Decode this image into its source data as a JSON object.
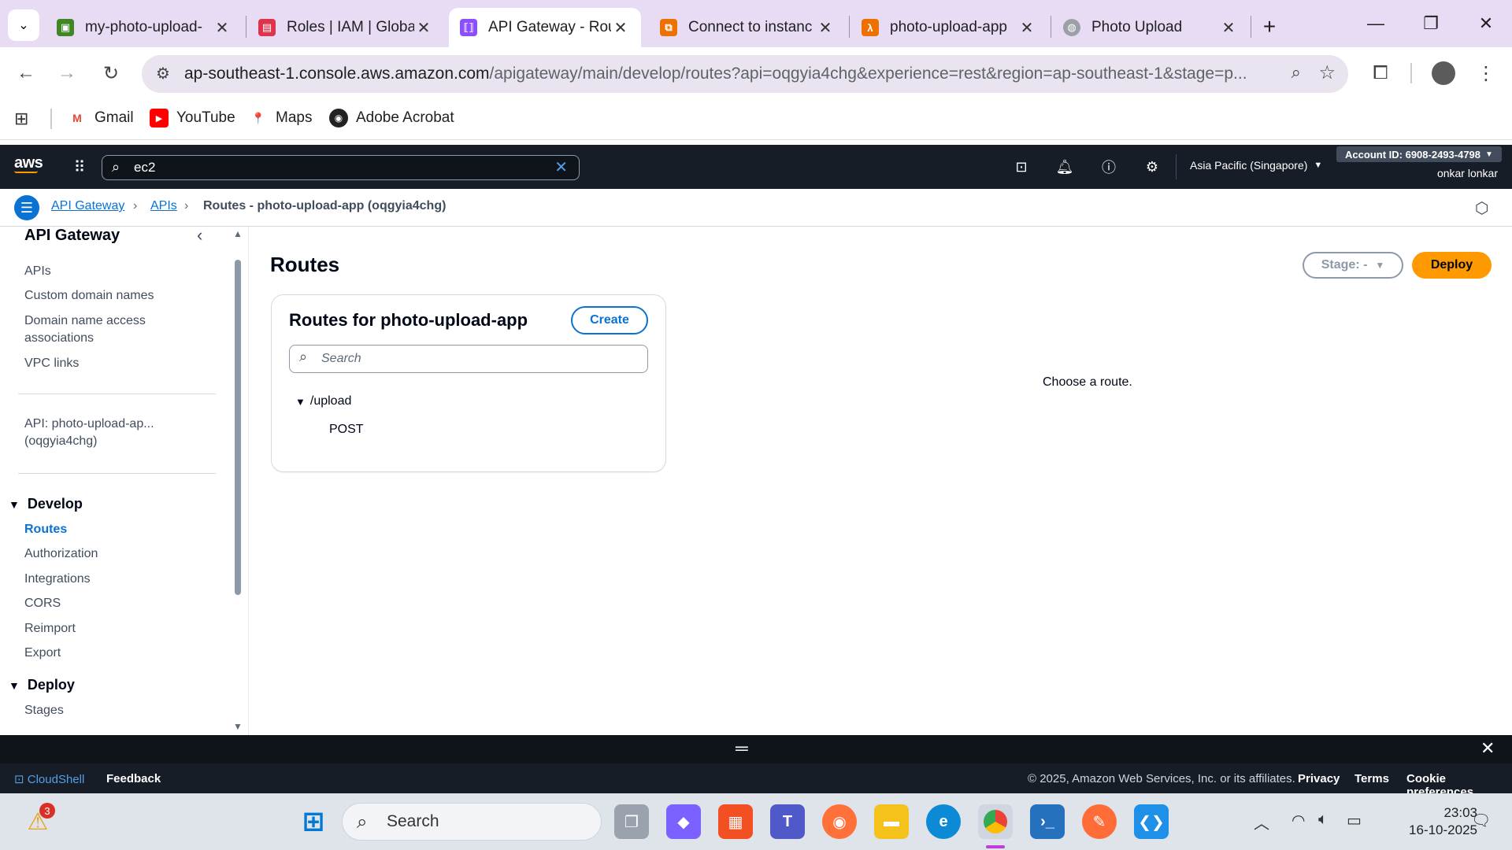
{
  "browser": {
    "tabs": [
      {
        "title": "my-photo-upload-",
        "favicon": "s3-icon",
        "color": "#3f8624"
      },
      {
        "title": "Roles | IAM | Globa",
        "favicon": "iam-icon",
        "color": "#dd344c"
      },
      {
        "title": "API Gateway - Rou",
        "favicon": "api-gateway-icon",
        "color": "#8c4fff"
      },
      {
        "title": "Connect to instanc",
        "favicon": "ec2-icon",
        "color": "#ed7100"
      },
      {
        "title": "photo-upload-app",
        "favicon": "lambda-icon",
        "color": "#ed7100"
      },
      {
        "title": "Photo Upload",
        "favicon": "globe-icon",
        "color": "#9aa0a6"
      }
    ],
    "active_tab_index": 2,
    "url_host": "ap-southeast-1.console.aws.amazon.com",
    "url_rest": "/apigateway/main/develop/routes?api=oqgyia4chg&experience=rest&region=ap-southeast-1&stage=p...",
    "bookmarks": [
      {
        "label": "Gmail",
        "icon": "gmail-icon"
      },
      {
        "label": "YouTube",
        "icon": "youtube-icon"
      },
      {
        "label": "Maps",
        "icon": "maps-icon"
      },
      {
        "label": "Adobe Acrobat",
        "icon": "acrobat-icon"
      }
    ]
  },
  "aws_nav": {
    "search_value": "ec2",
    "region": "Asia Pacific (Singapore)",
    "account_id": "Account ID: 6908-2493-4798",
    "user": "onkar lonkar"
  },
  "breadcrumb": {
    "items": [
      "API Gateway",
      "APIs",
      "Routes - photo-upload-app (oqgyia4chg)"
    ]
  },
  "sidebar": {
    "title": "API Gateway",
    "top_items": [
      "APIs",
      "Custom domain names",
      "Domain name access associations",
      "VPC links"
    ],
    "api_label": "API: photo-upload-ap... (oqgyia4chg)",
    "sections": [
      {
        "label": "Develop",
        "items": [
          "Routes",
          "Authorization",
          "Integrations",
          "CORS",
          "Reimport",
          "Export"
        ],
        "active": "Routes"
      },
      {
        "label": "Deploy",
        "items": [
          "Stages"
        ]
      }
    ]
  },
  "main": {
    "title": "Routes",
    "stage_label": "Stage: -",
    "deploy_label": "Deploy",
    "card_title": "Routes for photo-upload-app",
    "create_label": "Create",
    "search_placeholder": "Search",
    "route_path": "/upload",
    "route_method": "POST",
    "empty_message": "Choose a route."
  },
  "footer": {
    "cloudshell": "CloudShell",
    "feedback": "Feedback",
    "copyright": "© 2025, Amazon Web Services, Inc. or its affiliates.",
    "privacy": "Privacy",
    "terms": "Terms",
    "cookie": "Cookie preferences"
  },
  "taskbar": {
    "search_label": "Search",
    "notification_count": "3",
    "time": "23:03",
    "date": "16-10-2025"
  },
  "colors": {
    "aws_nav_bg": "#161d26",
    "link_blue": "#0972d3",
    "deploy_orange": "#ff9900",
    "chrome_tabstrip": "#e8dcf5"
  }
}
